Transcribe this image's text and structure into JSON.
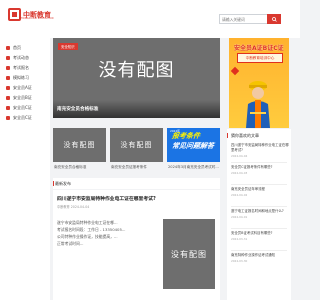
{
  "header": {
    "logo_text": "中断教育",
    "logo_sub": "ZHONGDUAN EDUCATION",
    "search_placeholder": "请输入关键词"
  },
  "sidebar": {
    "items": [
      {
        "label": "首页",
        "icon": "home-icon"
      },
      {
        "label": "考试动态",
        "icon": "news-icon"
      },
      {
        "label": "考试报名",
        "icon": "signup-icon"
      },
      {
        "label": "模拟练习",
        "icon": "practice-icon"
      },
      {
        "label": "安全员A证",
        "icon": "cert-a-icon"
      },
      {
        "label": "安全员B证",
        "icon": "cert-b-icon"
      },
      {
        "label": "安全员C证",
        "icon": "cert-c-icon"
      },
      {
        "label": "安全员C证",
        "icon": "cert-c2-icon"
      }
    ]
  },
  "hero": {
    "tag": "安全知识",
    "image_text": "没有配图",
    "caption": "南充安全员合格标准"
  },
  "banner": {
    "title": "安全员A证B证C证",
    "subtitle": "中断教育培训中心",
    "accent": "#e0301e"
  },
  "thumbs": [
    {
      "image_text": "没有配图",
      "caption": "南充安全员合格标准"
    },
    {
      "image_text": "没有配图",
      "caption": "南充安全员证报考条件"
    },
    {
      "ad_pre": "2024年",
      "ad_line1": "报考条件",
      "ad_line2": "常见问题解答",
      "caption": "2024年3月南充安全员考试时..."
    }
  ],
  "section": {
    "title": "最新发布"
  },
  "post": {
    "title": "四川遂宁市安监局特种作业电工证在哪里考试?",
    "meta": "中断教育 2024-04-04",
    "lines": [
      "遂宁市安监局特种作业电工证在哪...",
      "考试报名时间段：工作日 - 13350405...",
      "公司特种作业操作证，技能提高，...",
      "正常考试时间..."
    ],
    "image_text": "没有配图"
  },
  "right_list": {
    "title": "猜你喜欢的文章",
    "items": [
      {
        "q": "四川遂宁市安监局特种作业电工证在哪里考试?",
        "d": "2024-04-04"
      },
      {
        "q": "安全员C证报考条件有哪些?",
        "d": "2024-04-03"
      },
      {
        "q": "南充安全员证年审流程",
        "d": "2024-04-02"
      },
      {
        "q": "遂宁电工证报名时间和地点是什么?",
        "d": "2024-04-01"
      },
      {
        "q": "安全员B证考试科目有哪些?",
        "d": "2024-03-31"
      },
      {
        "q": "南充特种作业操作证考试通知",
        "d": "2024-03-30"
      }
    ]
  }
}
